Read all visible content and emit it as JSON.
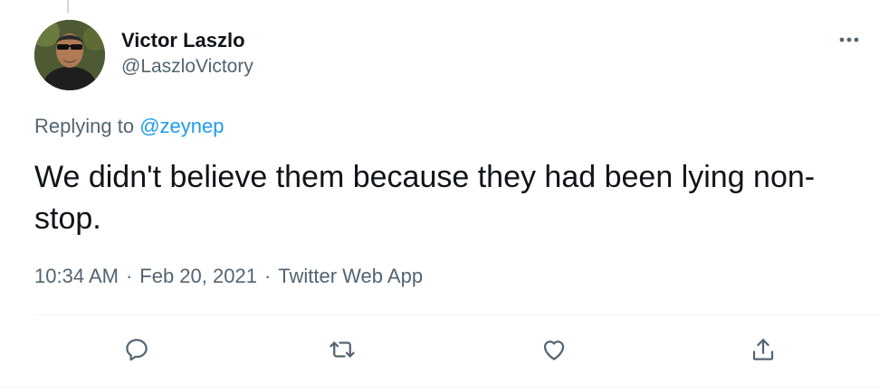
{
  "tweet": {
    "author_name": "Victor Laszlo",
    "author_handle": "@LaszloVictory",
    "replying_prefix": "Replying to",
    "replying_to": "@zeynep",
    "text": "We didn't believe them because they had been lying non-stop.",
    "time": "10:34 AM",
    "date": "Feb 20, 2021",
    "source": "Twitter Web App",
    "separator": "·"
  },
  "icons": {
    "more": "more-horizontal-icon",
    "reply": "reply-icon",
    "retweet": "retweet-icon",
    "like": "heart-icon",
    "share": "share-icon"
  },
  "colors": {
    "accent": "#1d9bf0",
    "secondary_text": "#536471",
    "primary_text": "#0f1419"
  }
}
